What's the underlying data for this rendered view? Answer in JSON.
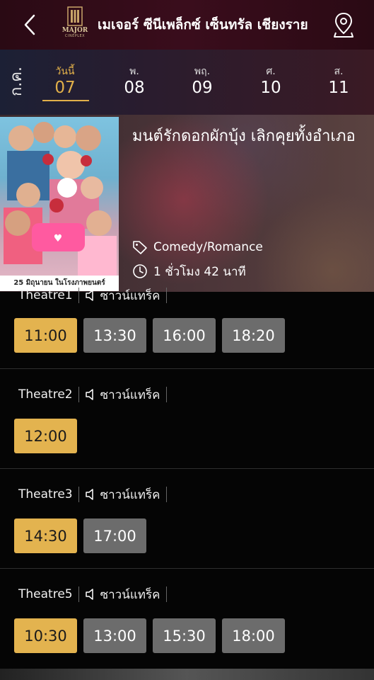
{
  "header": {
    "cinema_title": "เมเจอร์ ซีนีเพล็กซ์ เซ็นทรัล เชียงราย",
    "logo_word": "MAJOR",
    "logo_sub": "CINEPLEX",
    "back_icon": "chevron-left-icon",
    "map_icon": "map-pin-icon"
  },
  "dates": {
    "month": "ก.ค.",
    "days": [
      {
        "dow": "วันนี้",
        "num": "07",
        "active": true
      },
      {
        "dow": "พ.",
        "num": "08"
      },
      {
        "dow": "พฤ.",
        "num": "09"
      },
      {
        "dow": "ศ.",
        "num": "10"
      },
      {
        "dow": "ส.",
        "num": "11"
      }
    ],
    "accent_color": "#e2b04a"
  },
  "movie": {
    "title": "มนต์รักดอกผักบุ้ง เลิกคุยทั้งอำเภอ",
    "genre": "Comedy/Romance",
    "duration": "1 ชั่วโมง 42 นาที",
    "poster_caption": "25 มิถุนายน ในโรงภาพยนตร์"
  },
  "theatres": [
    {
      "name": "Theatre1",
      "sound": "ซาวน์แทร็ค",
      "times": [
        "11:00",
        "13:30",
        "16:00",
        "18:20"
      ],
      "highlight_index": 0
    },
    {
      "name": "Theatre2",
      "sound": "ซาวน์แทร็ค",
      "times": [
        "12:00"
      ],
      "highlight_index": 0
    },
    {
      "name": "Theatre3",
      "sound": "ซาวน์แทร็ค",
      "times": [
        "14:30",
        "17:00"
      ],
      "highlight_index": 0
    },
    {
      "name": "Theatre5",
      "sound": "ซาวน์แทร็ค",
      "times": [
        "10:30",
        "13:00",
        "15:30",
        "18:00"
      ],
      "highlight_index": 0
    }
  ],
  "colors": {
    "highlight_time": "#e3b34f",
    "normal_time": "#6c6c6c"
  }
}
